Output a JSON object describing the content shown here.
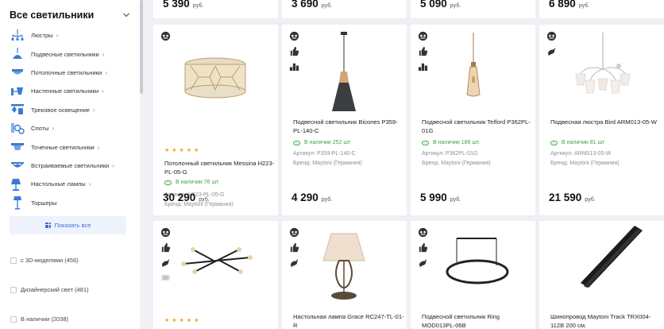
{
  "sidebar": {
    "title": "Все светильники",
    "categories": [
      {
        "label": "Люстры",
        "icon": "chandelier-icon"
      },
      {
        "label": "Подвесные светильники",
        "icon": "pendant-lamp-icon"
      },
      {
        "label": "Потолочные светильники",
        "icon": "ceiling-lamp-icon"
      },
      {
        "label": "Настенные светильники",
        "icon": "wall-lamp-icon"
      },
      {
        "label": "Трековое освещение",
        "icon": "track-light-icon"
      },
      {
        "label": "Споты",
        "icon": "spot-light-icon"
      },
      {
        "label": "Точечные светильники",
        "icon": "point-light-icon"
      },
      {
        "label": "Встраиваемые светильники",
        "icon": "recessed-light-icon"
      },
      {
        "label": "Настольные лампы",
        "icon": "desk-lamp-icon"
      },
      {
        "label": "Торшеры",
        "icon": "floor-lamp-icon"
      }
    ],
    "show_all": "Показать все",
    "filters": [
      {
        "label": "с 3D-моделями (456)"
      },
      {
        "label": "Дизайнерский свет (481)"
      },
      {
        "label": "В наличии (2038)"
      }
    ]
  },
  "top_prices": [
    {
      "price": "5 390",
      "currency": "руб."
    },
    {
      "price": "3 690",
      "currency": "руб."
    },
    {
      "price": "5 090",
      "currency": "руб."
    },
    {
      "price": "6 890",
      "currency": "руб."
    }
  ],
  "products": [
    {
      "name": "Потолочный светильник Messina H223-PL-05-G",
      "stars": "★★★★★",
      "stock": "В наличии 76 шт",
      "article": "Артикул: H223-PL-05-G",
      "brand": "Бренд: Maytoni (Германия)",
      "price": "30 290",
      "currency": "руб."
    },
    {
      "name": "Подвесной светильник Bicones P359-PL-140-C",
      "stock": "В наличии 252 шт",
      "article": "Артикул: P359-PL-140-C",
      "brand": "Бренд: Maytoni (Германия)",
      "price": "4 290",
      "currency": "руб."
    },
    {
      "name": "Подвесной светильник Telford P362PL-01G",
      "stock": "В наличии 186 шт.",
      "article": "Артикул: P362PL-01G",
      "brand": "Бренд: Maytoni (Германия)",
      "price": "5 990",
      "currency": "руб."
    },
    {
      "name": "Подвесная люстра Bird ARM013-05-W",
      "stock": "В наличии 81 шт",
      "article": "Артикул: ARM013-05-W",
      "brand": "Бренд: Maytoni (Германия)",
      "price": "21 590",
      "currency": "руб."
    }
  ],
  "bottom_products": [
    {
      "name": "",
      "stars": "★★★★★"
    },
    {
      "name": "Настольная лампа Grace RC247-TL-01-R"
    },
    {
      "name": "Подвесной светильник Ring MOD013PL-06B"
    },
    {
      "name": "Шинопровод Maytoni Track TRX004-112B 200 см."
    }
  ],
  "badge_label_3d": "3D"
}
